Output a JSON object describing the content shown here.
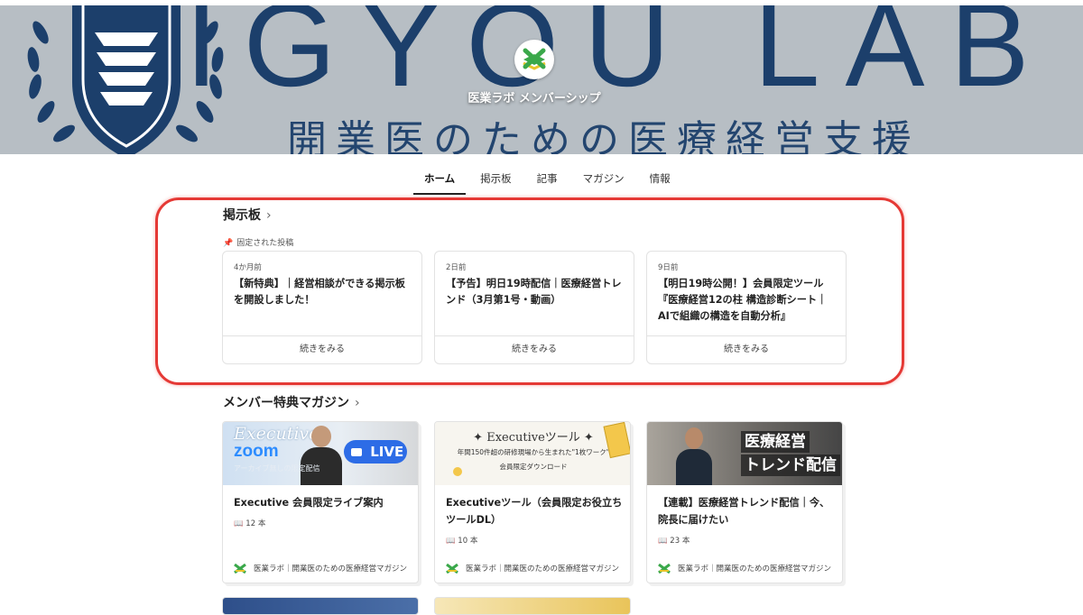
{
  "hero": {
    "banner_text": "IGYOU LAB",
    "banner_subtitle": "開業医のための医療経営支援",
    "brand_name": "医業ラボ メンバーシップ"
  },
  "tabs": [
    {
      "label": "ホーム",
      "active": true
    },
    {
      "label": "掲示板",
      "active": false
    },
    {
      "label": "記事",
      "active": false
    },
    {
      "label": "マガジン",
      "active": false
    },
    {
      "label": "情報",
      "active": false
    }
  ],
  "board": {
    "heading": "掲示板",
    "pinned_label": "固定された投稿",
    "more_label": "続きをみる",
    "posts": [
      {
        "date": "4か月前",
        "title": "【新特典】｜経営相談ができる掲示板を開設しました！"
      },
      {
        "date": "2日前",
        "title": "【予告】明日19時配信｜医療経営トレンド（3月第1号・動画）"
      },
      {
        "date": "9日前",
        "title": "【明日19時公開！】会員限定ツール『医療経営12の柱 構造診断シート｜AIで組織の構造を自動分析』"
      }
    ]
  },
  "magazines": {
    "heading": "メンバー特典マガジン",
    "items": [
      {
        "title": "Executive 会員限定ライブ案内",
        "count": "12 本",
        "author": "医業ラボ｜開業医のための医療経営マガジン",
        "thumb": {
          "script_word": "Executive",
          "zoom": "zoom",
          "live": "LIVE",
          "caption": "アーカイブ無しの限定配信"
        }
      },
      {
        "title": "Executiveツール（会員限定お役立ちツールDL）",
        "count": "10 本",
        "author": "医業ラボ｜開業医のための医療経営マガジン",
        "thumb": {
          "headline": "Executiveツール",
          "line1": "年間150件超の研修現場から生まれた\"1枚ワーク\"",
          "line2": "会員限定ダウンロード"
        }
      },
      {
        "title": "【連載】医療経営トレンド配信｜今、院長に届けたい",
        "count": "23 本",
        "author": "医業ラボ｜開業医のための医療経営マガジン",
        "thumb": {
          "line1": "医療経営",
          "line2": "トレンド配信"
        }
      }
    ]
  },
  "colors": {
    "accent_red": "#e53935",
    "navy": "#1c3f6b",
    "logo_green": "#3aa84a",
    "logo_yellow": "#e7c52b"
  }
}
